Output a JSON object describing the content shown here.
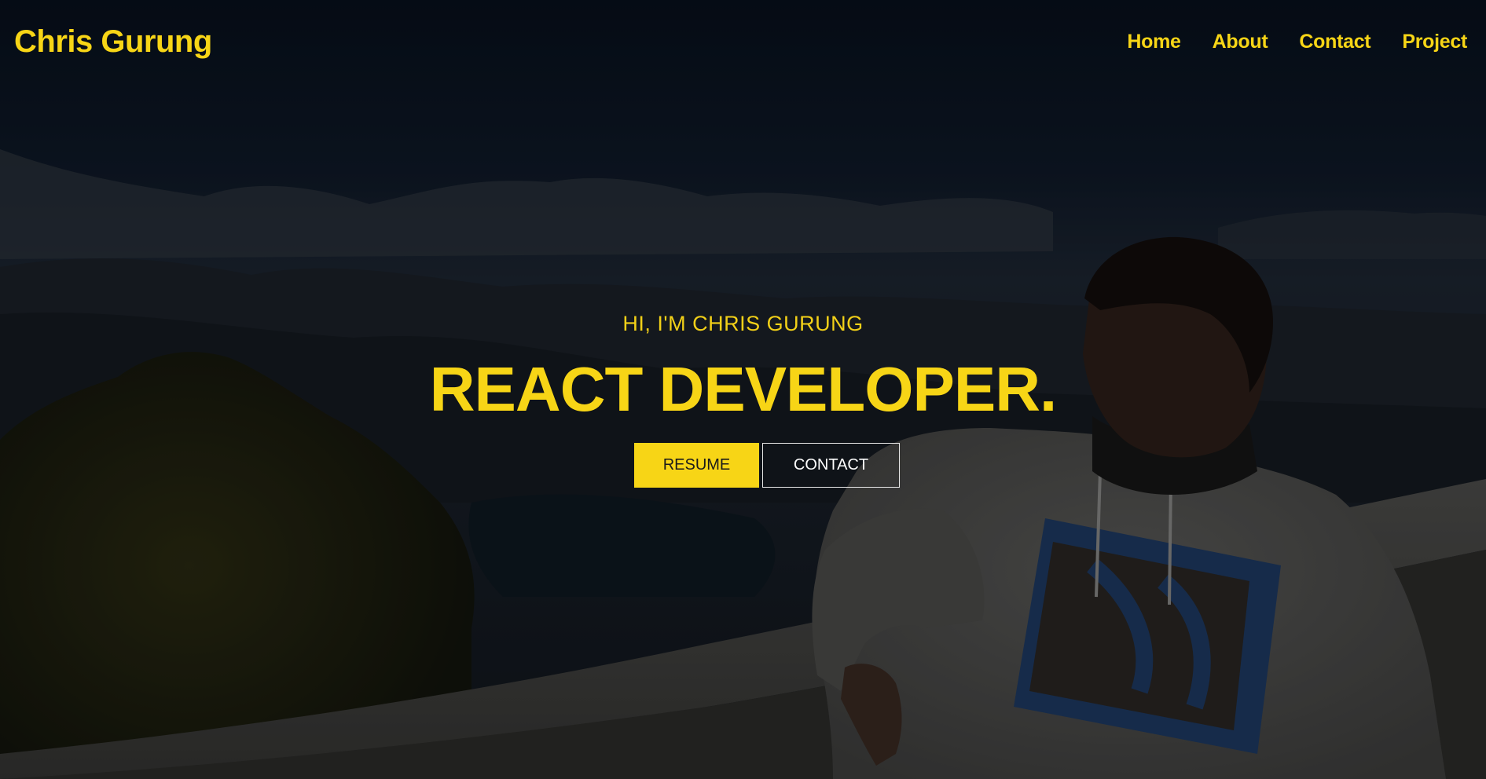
{
  "colors": {
    "accent": "#f7d516",
    "button_text_dark": "#1b1b1b",
    "button_text_light": "#ffffff"
  },
  "header": {
    "brand": "Chris Gurung",
    "nav": [
      {
        "label": "Home"
      },
      {
        "label": "About"
      },
      {
        "label": "Contact"
      },
      {
        "label": "Project"
      }
    ]
  },
  "hero": {
    "greeting": "HI, I'M CHRIS GURUNG",
    "headline": "REACT DEVELOPER.",
    "resume_label": "RESUME",
    "contact_label": "CONTACT",
    "background": "photo of person in white hoodie leaning on railing, mountains and lake behind"
  }
}
